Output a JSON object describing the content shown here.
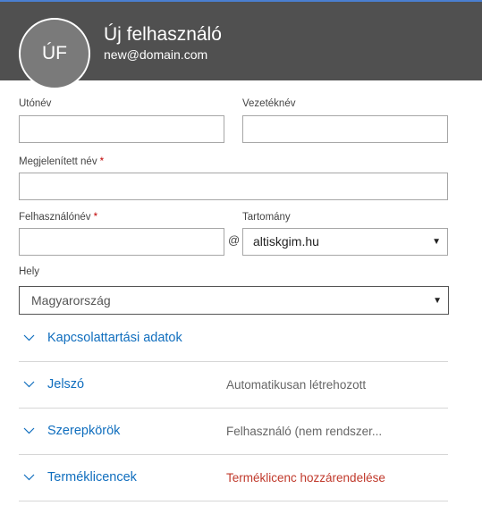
{
  "header": {
    "initials": "ÚF",
    "title": "Új felhasználó",
    "email": "new@domain.com"
  },
  "form": {
    "first_name": {
      "label": "Utónév",
      "value": ""
    },
    "last_name": {
      "label": "Vezetéknév",
      "value": ""
    },
    "display_name": {
      "label": "Megjelenített név",
      "required_mark": "*",
      "value": ""
    },
    "username": {
      "label": "Felhasználónév",
      "required_mark": "*",
      "value": ""
    },
    "at_symbol": "@",
    "domain": {
      "label": "Tartomány",
      "selected": "altiskgim.hu"
    },
    "location": {
      "label": "Hely",
      "selected": "Magyarország"
    }
  },
  "sections": [
    {
      "title": "Kapcsolattartási adatok",
      "value": ""
    },
    {
      "title": "Jelszó",
      "value": "Automatikusan létrehozott"
    },
    {
      "title": "Szerepkörök",
      "value": "Felhasználó (nem rendszer..."
    },
    {
      "title": "Terméklicencek",
      "value": "Terméklicenc hozzárendelése"
    }
  ],
  "colors": {
    "header_bg": "#505050",
    "link_blue": "#106ebe",
    "warning_red": "#c0392b",
    "required_red": "#c00000"
  }
}
